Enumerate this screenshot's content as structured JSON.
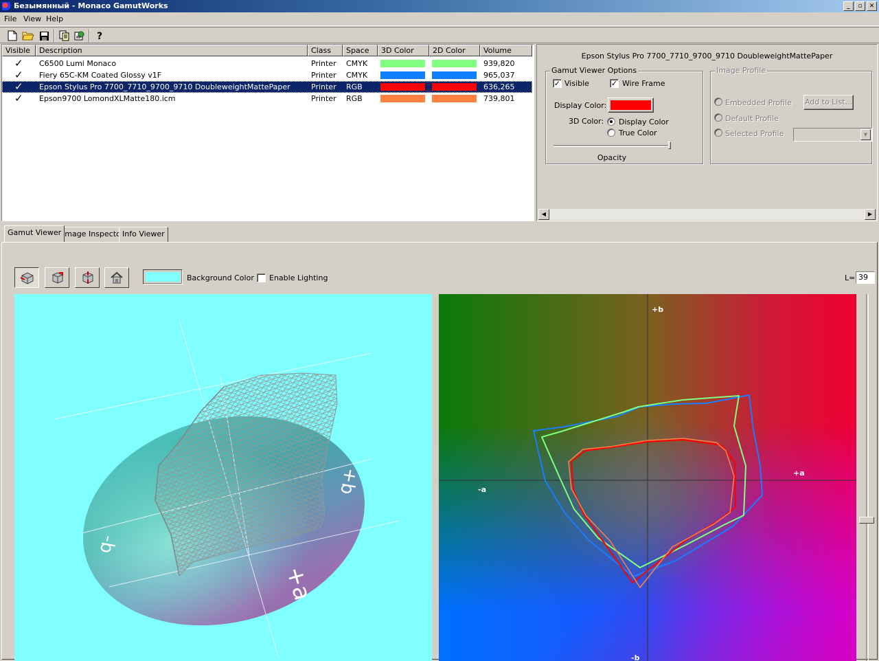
{
  "window": {
    "title": "Безымянный - Monaco GamutWorks"
  },
  "menu": [
    "File",
    "View",
    "Help"
  ],
  "list": {
    "columns": [
      "Visible",
      "Description",
      "Class",
      "Space",
      "3D Color",
      "2D Color",
      "Volume"
    ],
    "rows": [
      {
        "visible": true,
        "description": "C6500 Lumi Monaco",
        "class": "Printer",
        "space": "CMYK",
        "color3d": "#80ff80",
        "color2d": "#80ff80",
        "volume": "939,820",
        "selected": false
      },
      {
        "visible": true,
        "description": "Fiery 65C-KM Coated Glossy v1F",
        "class": "Printer",
        "space": "CMYK",
        "color3d": "#1080ff",
        "color2d": "#1080ff",
        "volume": "965,037",
        "selected": false
      },
      {
        "visible": true,
        "description": "Epson Stylus Pro 7700_7710_9700_9710 DoubleweightMattePaper",
        "class": "Printer",
        "space": "RGB",
        "color3d": "#ff0000",
        "color2d": "#ff0000",
        "volume": "636,265",
        "selected": true
      },
      {
        "visible": true,
        "description": "Epson9700 LomondXLMatte180.icm",
        "class": "Printer",
        "space": "RGB",
        "color3d": "#ff8040",
        "color2d": "#ff8040",
        "volume": "739,801",
        "selected": false
      }
    ]
  },
  "details": {
    "profile_title": "Epson Stylus Pro 7700_7710_9700_9710 DoubleweightMattePaper",
    "gamut_options": {
      "label": "Gamut Viewer Options",
      "visible_label": "Visible",
      "visible_checked": true,
      "wireframe_label": "Wire Frame",
      "wireframe_checked": true,
      "display_color_label": "Display Color:",
      "display_color": "#ff0000",
      "color3d_label": "3D Color:",
      "opt_display_color": "Display Color",
      "opt_true_color": "True Color",
      "opacity_label": "Opacity",
      "opacity": 1.0
    },
    "image_profile": {
      "label": "Image Profile",
      "embedded": "Embedded Profile",
      "default": "Default Profile",
      "selected": "Selected Profile",
      "add_button": "Add to List..."
    }
  },
  "tabs": [
    "Gamut Viewer",
    "Image Inspector",
    "Info Viewer"
  ],
  "viewer": {
    "background_color_label": "Background Color",
    "background_color": "#80ffff",
    "enable_lighting_label": "Enable Lighting",
    "enable_lighting": false,
    "l_label": "L=",
    "l_value": "39",
    "axis3d": {
      "minus_b": "-b",
      "plus_b": "+b",
      "plus_a": "+a"
    },
    "axis2d": {
      "plus_b": "+b",
      "minus_b": "-b",
      "minus_a": "-a",
      "plus_a": "+a"
    }
  },
  "icons": [
    "new-file-icon",
    "open-folder-icon",
    "save-disk-icon",
    "copy-icon",
    "properties-icon",
    "help-icon",
    "cube-view-icon",
    "cube-rotate-icon",
    "cube-zoom-icon",
    "home-view-icon"
  ]
}
